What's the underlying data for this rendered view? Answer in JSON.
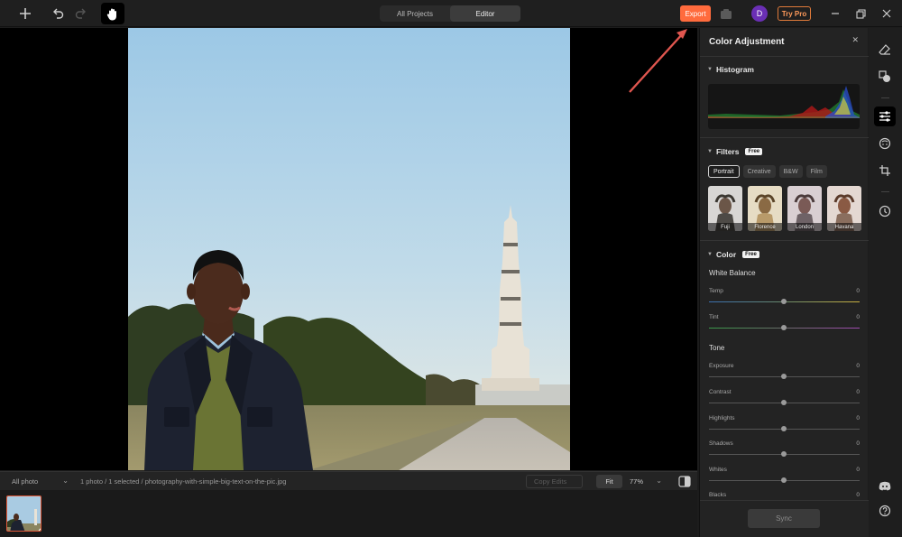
{
  "colors": {
    "accent": "#ff6b3d",
    "try_pro": "#ff9a5a",
    "avatar": "#6a2fb5"
  },
  "topbar": {
    "icons": [
      "plus-icon",
      "undo-icon",
      "redo-icon",
      "hand-icon"
    ],
    "tabs": [
      {
        "label": "All Projects",
        "active": false
      },
      {
        "label": "Editor",
        "active": true
      }
    ],
    "export_label": "Export",
    "avatar_initial": "D",
    "try_pro_label": "Try Pro"
  },
  "status": {
    "filter_label": "All photo",
    "info": "1 photo / 1 selected / photography-with-simple-big-text-on-the-pic.jpg",
    "copy_edits_label": "Copy Edits",
    "fit_label": "Fit",
    "zoom_label": "77%"
  },
  "panel": {
    "title": "Color Adjustment",
    "histogram_label": "Histogram",
    "filters_label": "Filters",
    "free_badge": "Free",
    "filter_tabs": [
      "Portrait",
      "Creative",
      "B&W",
      "Film"
    ],
    "presets": [
      "Fuji",
      "Florence",
      "London",
      "Havana"
    ],
    "color_label": "Color",
    "white_balance_label": "White Balance",
    "wb_sliders": [
      {
        "label": "Temp",
        "value": "0"
      },
      {
        "label": "Tint",
        "value": "0"
      }
    ],
    "tone_label": "Tone",
    "tone_sliders": [
      {
        "label": "Exposure",
        "value": "0"
      },
      {
        "label": "Contrast",
        "value": "0"
      },
      {
        "label": "Highlights",
        "value": "0"
      },
      {
        "label": "Shadows",
        "value": "0"
      },
      {
        "label": "Whites",
        "value": "0"
      },
      {
        "label": "Blacks",
        "value": "0"
      }
    ],
    "sync_label": "Sync"
  },
  "rail": [
    "eraser-icon",
    "shapes-icon",
    "adjust-sliders-icon",
    "face-retouch-icon",
    "crop-icon",
    "history-icon",
    "discord-icon",
    "help-icon"
  ]
}
